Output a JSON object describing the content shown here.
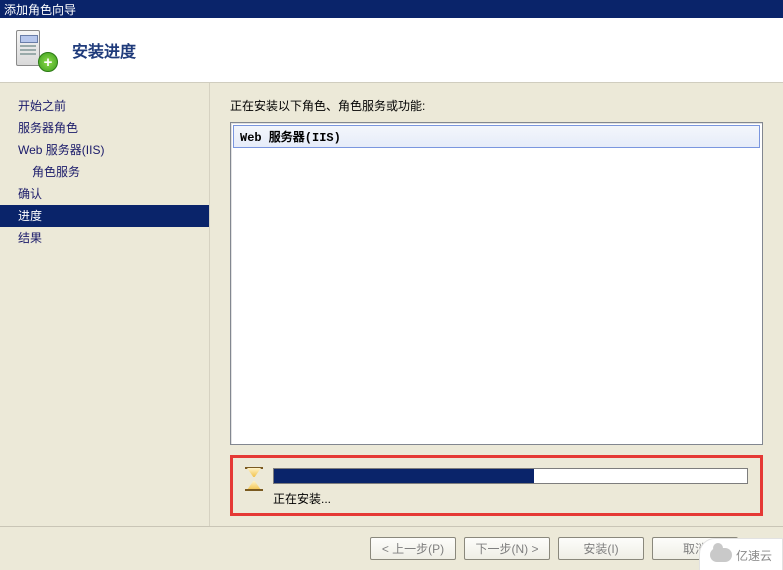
{
  "window": {
    "title": "添加角色向导"
  },
  "header": {
    "title": "安装进度"
  },
  "sidebar": {
    "items": [
      {
        "label": "开始之前",
        "indent": false,
        "active": false
      },
      {
        "label": "服务器角色",
        "indent": false,
        "active": false
      },
      {
        "label": "Web 服务器(IIS)",
        "indent": false,
        "active": false
      },
      {
        "label": "角色服务",
        "indent": true,
        "active": false
      },
      {
        "label": "确认",
        "indent": false,
        "active": false
      },
      {
        "label": "进度",
        "indent": false,
        "active": true
      },
      {
        "label": "结果",
        "indent": false,
        "active": false
      }
    ]
  },
  "content": {
    "heading": "正在安装以下角色、角色服务或功能:",
    "role_item": "Web 服务器(IIS)"
  },
  "progress": {
    "percent": 55,
    "status_text": "正在安装..."
  },
  "footer": {
    "prev": "< 上一步(P)",
    "next": "下一步(N) >",
    "install": "安装(I)",
    "cancel": "取消"
  },
  "watermark": {
    "text": "亿速云"
  }
}
